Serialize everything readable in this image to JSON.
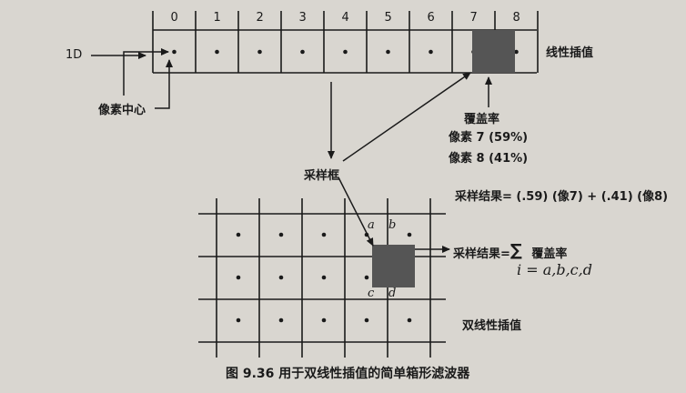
{
  "labels": {
    "input_1d": "1D",
    "pixel_center": "像素中心",
    "linear_interp": "线性插值",
    "coverage": "覆盖率",
    "pixel7": "像素 7 (59%)",
    "pixel8": "像素 8 (41%)",
    "sample_box": "采样框",
    "sample_result_1": "采样结果= (.59) (像7) + (.41) (像8)",
    "sample_result_2": "采样结果=",
    "sigma": "∑",
    "coverage_sum": "覆盖率",
    "index_expr": "i = a,b,c,d",
    "bilinear_interp": "双线性插值",
    "caption": "图 9.36   用于双线性插值的简单箱形滤波器"
  },
  "pixel_indices": [
    "0",
    "1",
    "2",
    "3",
    "4",
    "5",
    "6",
    "7",
    "8"
  ],
  "sub_labels": {
    "a": "a",
    "b": "b",
    "c": "c",
    "d": "d"
  },
  "colors": {
    "background": "#d9d6d0",
    "ink": "#1a1a1a",
    "sample_box": "#555555"
  }
}
